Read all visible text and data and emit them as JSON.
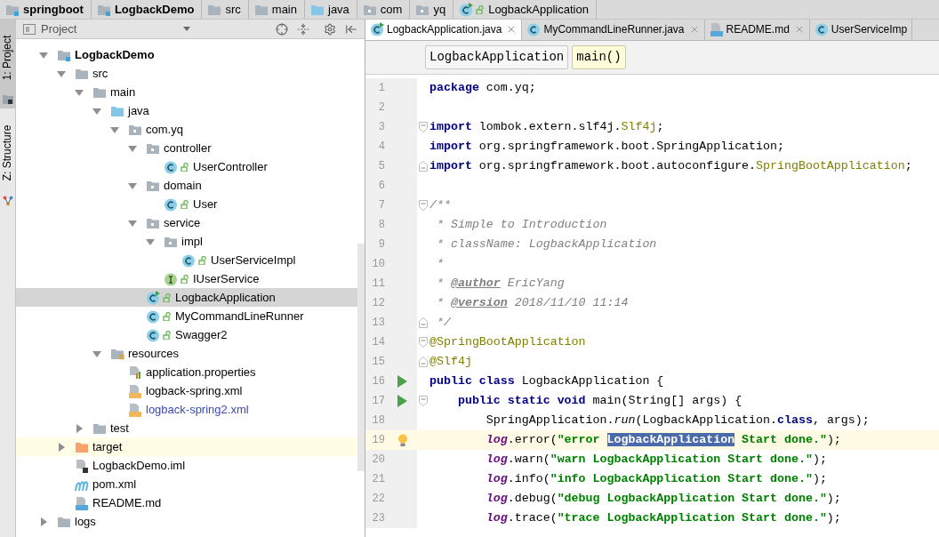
{
  "breadcrumb": [
    {
      "label": "springboot",
      "kind": "module"
    },
    {
      "label": "LogbackDemo",
      "kind": "module"
    },
    {
      "label": "src",
      "kind": "folder"
    },
    {
      "label": "main",
      "kind": "folder"
    },
    {
      "label": "java",
      "kind": "source-folder"
    },
    {
      "label": "com",
      "kind": "package"
    },
    {
      "label": "yq",
      "kind": "package"
    },
    {
      "label": "LogbackApplication",
      "kind": "run-class"
    }
  ],
  "tool_strip": [
    {
      "label": "1: Project",
      "kind": "project",
      "selected": true
    },
    {
      "label": "Z: Structure",
      "kind": "structure",
      "selected": false
    }
  ],
  "project_panel": {
    "title": "Project",
    "tree": [
      {
        "label": "LogbackDemo",
        "kind": "module",
        "expanded": true,
        "selected": false,
        "children": [
          {
            "label": "src",
            "kind": "folder",
            "expanded": true,
            "selected": false,
            "children": [
              {
                "label": "main",
                "kind": "folder",
                "expanded": true,
                "selected": false,
                "children": [
                  {
                    "label": "java",
                    "kind": "source-folder",
                    "expanded": true,
                    "selected": false,
                    "children": [
                      {
                        "label": "com.yq",
                        "kind": "package",
                        "expanded": true,
                        "selected": false,
                        "children": [
                          {
                            "label": "controller",
                            "kind": "package",
                            "expanded": true,
                            "selected": false,
                            "children": [
                              {
                                "label": "UserController",
                                "kind": "class",
                                "selected": false
                              }
                            ]
                          },
                          {
                            "label": "domain",
                            "kind": "package",
                            "expanded": true,
                            "selected": false,
                            "children": [
                              {
                                "label": "User",
                                "kind": "class",
                                "selected": false
                              }
                            ]
                          },
                          {
                            "label": "service",
                            "kind": "package",
                            "expanded": true,
                            "selected": false,
                            "children": [
                              {
                                "label": "impl",
                                "kind": "package",
                                "expanded": true,
                                "selected": false,
                                "children": [
                                  {
                                    "label": "UserServiceImpl",
                                    "kind": "class",
                                    "selected": false
                                  }
                                ]
                              },
                              {
                                "label": "IUserService",
                                "kind": "interface",
                                "selected": false
                              }
                            ]
                          },
                          {
                            "label": "LogbackApplication",
                            "kind": "run-class",
                            "selected": true
                          },
                          {
                            "label": "MyCommandLineRunner",
                            "kind": "class",
                            "selected": false
                          },
                          {
                            "label": "Swagger2",
                            "kind": "class",
                            "selected": false
                          }
                        ]
                      }
                    ]
                  },
                  {
                    "label": "resources",
                    "kind": "resources-folder",
                    "expanded": true,
                    "selected": false,
                    "children": [
                      {
                        "label": "application.properties",
                        "kind": "properties",
                        "selected": false
                      },
                      {
                        "label": "logback-spring.xml",
                        "kind": "xml",
                        "selected": false
                      },
                      {
                        "label": "logback-spring2.xml",
                        "kind": "xml",
                        "vcs_added": true,
                        "selected": false
                      }
                    ]
                  }
                ]
              },
              {
                "label": "test",
                "kind": "folder",
                "expanded": false,
                "selected": false
              }
            ]
          },
          {
            "label": "target",
            "kind": "excluded-folder",
            "expanded": false,
            "selected": false,
            "highlighted": true
          },
          {
            "label": "LogbackDemo.iml",
            "kind": "iml",
            "selected": false
          },
          {
            "label": "pom.xml",
            "kind": "maven",
            "selected": false
          },
          {
            "label": "README.md",
            "kind": "markdown",
            "selected": false
          }
        ]
      },
      {
        "label": "logs",
        "kind": "folder",
        "expanded": false,
        "selected": false
      }
    ]
  },
  "editor_tabs": [
    {
      "label": "LogbackApplication.java",
      "kind": "run-class",
      "selected": true
    },
    {
      "label": "MyCommandLineRunner.java",
      "kind": "class",
      "selected": false
    },
    {
      "label": "README.md",
      "kind": "markdown",
      "selected": false
    },
    {
      "label": "UserServiceImp",
      "kind": "class",
      "selected": false
    }
  ],
  "structure_path": [
    {
      "label": "LogbackApplication",
      "selected": false
    },
    {
      "label": "main()",
      "selected": true
    }
  ],
  "code_lines": [
    {
      "number": "1",
      "current": false,
      "tokens": [
        {
          "kind": "keyword",
          "text": "package"
        },
        {
          "kind": "plain",
          "text": " com.yq;"
        }
      ]
    },
    {
      "number": "2",
      "current": false
    },
    {
      "number": "3",
      "current": false,
      "fold_start": true,
      "tokens": [
        {
          "kind": "keyword",
          "text": "import"
        },
        {
          "kind": "plain",
          "text": " lombok.extern.slf4j."
        },
        {
          "kind": "annotation",
          "text": "Slf4j"
        },
        {
          "kind": "plain",
          "text": ";"
        }
      ]
    },
    {
      "number": "4",
      "current": false,
      "tokens": [
        {
          "kind": "keyword",
          "text": "import"
        },
        {
          "kind": "plain",
          "text": " org.springframework.boot.SpringApplication;"
        }
      ]
    },
    {
      "number": "5",
      "current": false,
      "fold_end": true,
      "tokens": [
        {
          "kind": "keyword",
          "text": "import"
        },
        {
          "kind": "plain",
          "text": " org.springframework.boot.autoconfigure."
        },
        {
          "kind": "annotation",
          "text": "SpringBootApplication"
        },
        {
          "kind": "plain",
          "text": ";"
        }
      ]
    },
    {
      "number": "6",
      "current": false
    },
    {
      "number": "7",
      "current": false,
      "fold_start": true,
      "tokens": [
        {
          "kind": "doc",
          "text": "/**"
        }
      ]
    },
    {
      "number": "8",
      "current": false,
      "tokens": [
        {
          "kind": "doc",
          "text": " * Simple to Introduction"
        }
      ]
    },
    {
      "number": "9",
      "current": false,
      "tokens": [
        {
          "kind": "doc",
          "text": " * className: LogbackApplication"
        }
      ]
    },
    {
      "number": "10",
      "current": false,
      "tokens": [
        {
          "kind": "doc",
          "text": " *"
        }
      ]
    },
    {
      "number": "11",
      "current": false,
      "tokens": [
        {
          "kind": "doc",
          "text": " * "
        },
        {
          "kind": "doc-tag",
          "text": "@author"
        },
        {
          "kind": "doc",
          "text": " EricYang"
        }
      ]
    },
    {
      "number": "12",
      "current": false,
      "tokens": [
        {
          "kind": "doc",
          "text": " * "
        },
        {
          "kind": "doc-tag",
          "text": "@version"
        },
        {
          "kind": "doc",
          "text": " 2018/11/10 11:14"
        }
      ]
    },
    {
      "number": "13",
      "current": false,
      "fold_end": true,
      "tokens": [
        {
          "kind": "doc",
          "text": " */"
        }
      ]
    },
    {
      "number": "14",
      "current": false,
      "fold_start": true,
      "tokens": [
        {
          "kind": "annotation",
          "text": "@SpringBootApplication"
        }
      ]
    },
    {
      "number": "15",
      "current": false,
      "fold_end": true,
      "tokens": [
        {
          "kind": "annotation",
          "text": "@Slf4j"
        }
      ]
    },
    {
      "number": "16",
      "current": false,
      "run_marker": true,
      "tokens": [
        {
          "kind": "keyword",
          "text": "public class"
        },
        {
          "kind": "plain",
          "text": " LogbackApplication {"
        }
      ]
    },
    {
      "number": "17",
      "current": false,
      "run_marker": true,
      "fold_start": true,
      "tokens": [
        {
          "kind": "keyword",
          "text": "    public static void"
        },
        {
          "kind": "plain",
          "text": " main(String[] args) {"
        }
      ]
    },
    {
      "number": "18",
      "current": false,
      "tokens": [
        {
          "kind": "plain",
          "text": "        SpringApplication."
        },
        {
          "kind": "static",
          "text": "run"
        },
        {
          "kind": "plain",
          "text": "(LogbackApplication."
        },
        {
          "kind": "keyword",
          "text": "class"
        },
        {
          "kind": "plain",
          "text": ", args);"
        }
      ]
    },
    {
      "number": "19",
      "current": true,
      "intention_bulb": true,
      "tokens": [
        {
          "kind": "field",
          "text": "        log"
        },
        {
          "kind": "plain",
          "text": ".error("
        },
        {
          "kind": "string",
          "text": "\"error "
        },
        {
          "kind": "selection",
          "text": "LogbackApplication"
        },
        {
          "kind": "string",
          "text": " Start done.\""
        },
        {
          "kind": "plain",
          "text": ");"
        }
      ]
    },
    {
      "number": "20",
      "current": false,
      "tokens": [
        {
          "kind": "field",
          "text": "        log"
        },
        {
          "kind": "plain",
          "text": ".warn("
        },
        {
          "kind": "string",
          "text": "\"warn LogbackApplication Start done.\""
        },
        {
          "kind": "plain",
          "text": ");"
        }
      ]
    },
    {
      "number": "21",
      "current": false,
      "tokens": [
        {
          "kind": "field",
          "text": "        log"
        },
        {
          "kind": "plain",
          "text": ".info("
        },
        {
          "kind": "string",
          "text": "\"info LogbackApplication Start done.\""
        },
        {
          "kind": "plain",
          "text": ");"
        }
      ]
    },
    {
      "number": "22",
      "current": false,
      "tokens": [
        {
          "kind": "field",
          "text": "        log"
        },
        {
          "kind": "plain",
          "text": ".debug("
        },
        {
          "kind": "string",
          "text": "\"debug LogbackApplication Start done.\""
        },
        {
          "kind": "plain",
          "text": ");"
        }
      ]
    },
    {
      "number": "23",
      "current": false,
      "tokens": [
        {
          "kind": "field",
          "text": "        log"
        },
        {
          "kind": "plain",
          "text": ".trace("
        },
        {
          "kind": "string",
          "text": "\"trace LogbackApplication Start done.\""
        },
        {
          "kind": "plain",
          "text": ");"
        }
      ]
    }
  ]
}
